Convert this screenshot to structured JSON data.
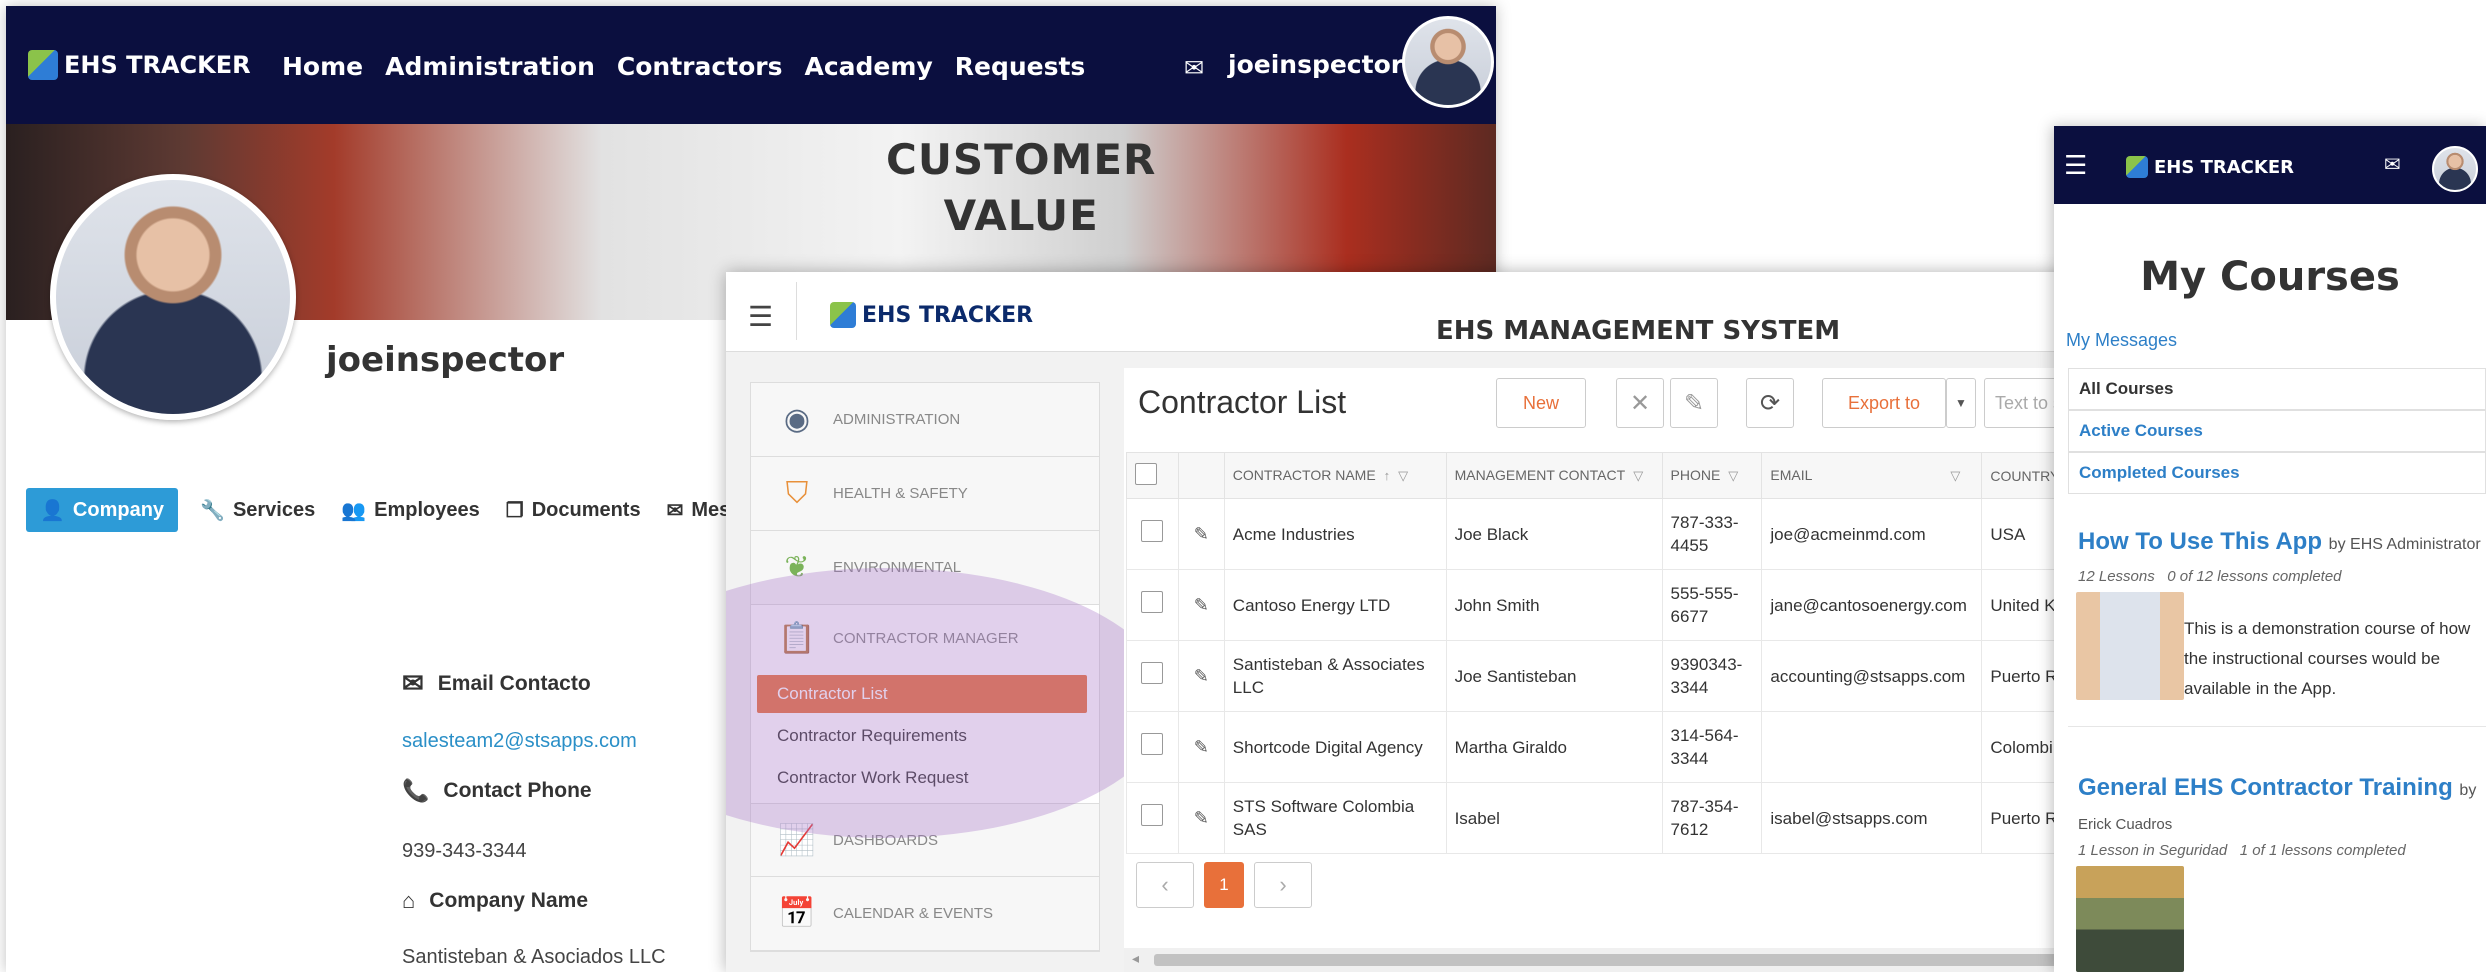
{
  "profile": {
    "logo_text": "EHS TRACKER",
    "nav": [
      "Home",
      "Administration",
      "Contractors",
      "Academy",
      "Requests"
    ],
    "username": "joeinspector",
    "banner_text_1": "CUSTOMER",
    "banner_text_2": "VALUE",
    "tabs": [
      {
        "label": "Company",
        "icon": "person-icon"
      },
      {
        "label": "Services",
        "icon": "wrench-icon"
      },
      {
        "label": "Employees",
        "icon": "people-icon"
      },
      {
        "label": "Documents",
        "icon": "documents-icon"
      },
      {
        "label": "Messa",
        "icon": "envelope-icon"
      }
    ],
    "email_label": "Email Contacto",
    "email_value": "salesteam2@stsapps.com",
    "phone_label": "Contact Phone",
    "phone_value": "939-343-3344",
    "company_label": "Company Name",
    "company_value": "Santisteban & Asociados LLC"
  },
  "ehs": {
    "logo_text": "EHS TRACKER",
    "system_title": "EHS MANAGEMENT SYSTEM",
    "sidebar": [
      {
        "label": "ADMINISTRATION",
        "icon": "admin-icon"
      },
      {
        "label": "HEALTH & SAFETY",
        "icon": "shield-icon"
      },
      {
        "label": "ENVIRONMENTAL",
        "icon": "leaf-icon"
      },
      {
        "label": "CONTRACTOR MANAGER",
        "icon": "clipboard-icon"
      }
    ],
    "submenu": [
      "Contractor List",
      "Contractor Requirements",
      "Contractor Work Request"
    ],
    "sidebar_bottom": [
      {
        "label": "DASHBOARDS",
        "icon": "chart-icon"
      },
      {
        "label": "CALENDAR & EVENTS",
        "icon": "calendar-icon"
      }
    ],
    "list_title": "Contractor List",
    "buttons": {
      "new": "New",
      "export": "Export to"
    },
    "search_placeholder": "Text to s",
    "columns": [
      "CONTRACTOR NAME",
      "MANAGEMENT CONTACT",
      "PHONE",
      "EMAIL",
      "COUNTRY"
    ],
    "rows": [
      {
        "name": "Acme Industries",
        "contact": "Joe Black",
        "phone": "787-333-4455",
        "email": "joe@acmeinmd.com",
        "country": "USA"
      },
      {
        "name": "Cantoso Energy LTD",
        "contact": "John Smith",
        "phone": "555-555-6677",
        "email": "jane@cantosoenergy.com",
        "country": "United Kingdom"
      },
      {
        "name": "Santisteban & Associates LLC",
        "contact": "Joe Santisteban",
        "phone": "9390343-3344",
        "email": "accounting@stsapps.com",
        "country": "Puerto R"
      },
      {
        "name": "Shortcode Digital Agency",
        "contact": "Martha Giraldo",
        "phone": "314-564-3344",
        "email": "",
        "country": "Colombi"
      },
      {
        "name": "STS Software Colombia SAS",
        "contact": "Isabel",
        "phone": "787-354-7612",
        "email": "isabel@stsapps.com",
        "country": "Puerto R"
      }
    ],
    "current_page": "1"
  },
  "mobile": {
    "logo_text": "EHS TRACKER",
    "title": "My Courses",
    "my_messages": "My Messages",
    "tabs": [
      "All Courses",
      "Active Courses",
      "Completed Courses"
    ],
    "course1": {
      "title": "How To Use This App",
      "by": "by EHS Administrator",
      "lessons": "12 Lessons",
      "progress": "0 of 12 lessons completed",
      "description": "This is a demonstration course of how the instructional courses would be available in the App."
    },
    "course2": {
      "title": "General EHS Contractor Training",
      "by": "by",
      "author": "Erick Cuadros",
      "lessons": "1 Lesson in Seguridad",
      "progress": "1 of 1 lessons completed"
    }
  },
  "colors": {
    "navy": "#0b0f3f",
    "accent_blue": "#2d9bd7",
    "accent_orange": "#e8703a",
    "link_blue": "#2d7fc7"
  }
}
